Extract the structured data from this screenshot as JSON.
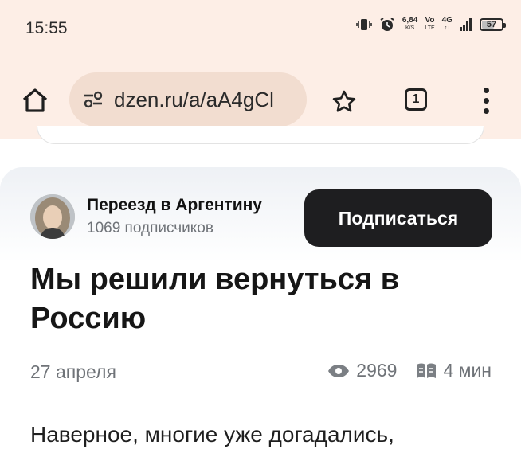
{
  "status_bar": {
    "time": "15:55",
    "net_speed": "6,84",
    "net_speed_unit": "K/S",
    "volte_top": "Vo",
    "volte_bottom": "LTE",
    "network_type": "4G",
    "battery": "57"
  },
  "browser": {
    "url": "dzen.ru/a/aA4gCl",
    "tab_count": "1"
  },
  "channel": {
    "name": "Переезд в Аргентину",
    "subscribers": "1069 подписчиков",
    "subscribe_label": "Подписаться"
  },
  "article": {
    "title": "Мы решили вернуться в Россию",
    "date": "27 апреля",
    "views": "2969",
    "read_time": "4 мин",
    "body_first_line": "Наверное, многие уже догадались,"
  },
  "icons": [
    "vibrate-icon",
    "alarm-icon",
    "signal-icon",
    "battery-icon",
    "home-icon",
    "site-settings-icon",
    "star-icon",
    "tabs-icon",
    "more-menu-icon",
    "eye-icon",
    "book-icon"
  ]
}
